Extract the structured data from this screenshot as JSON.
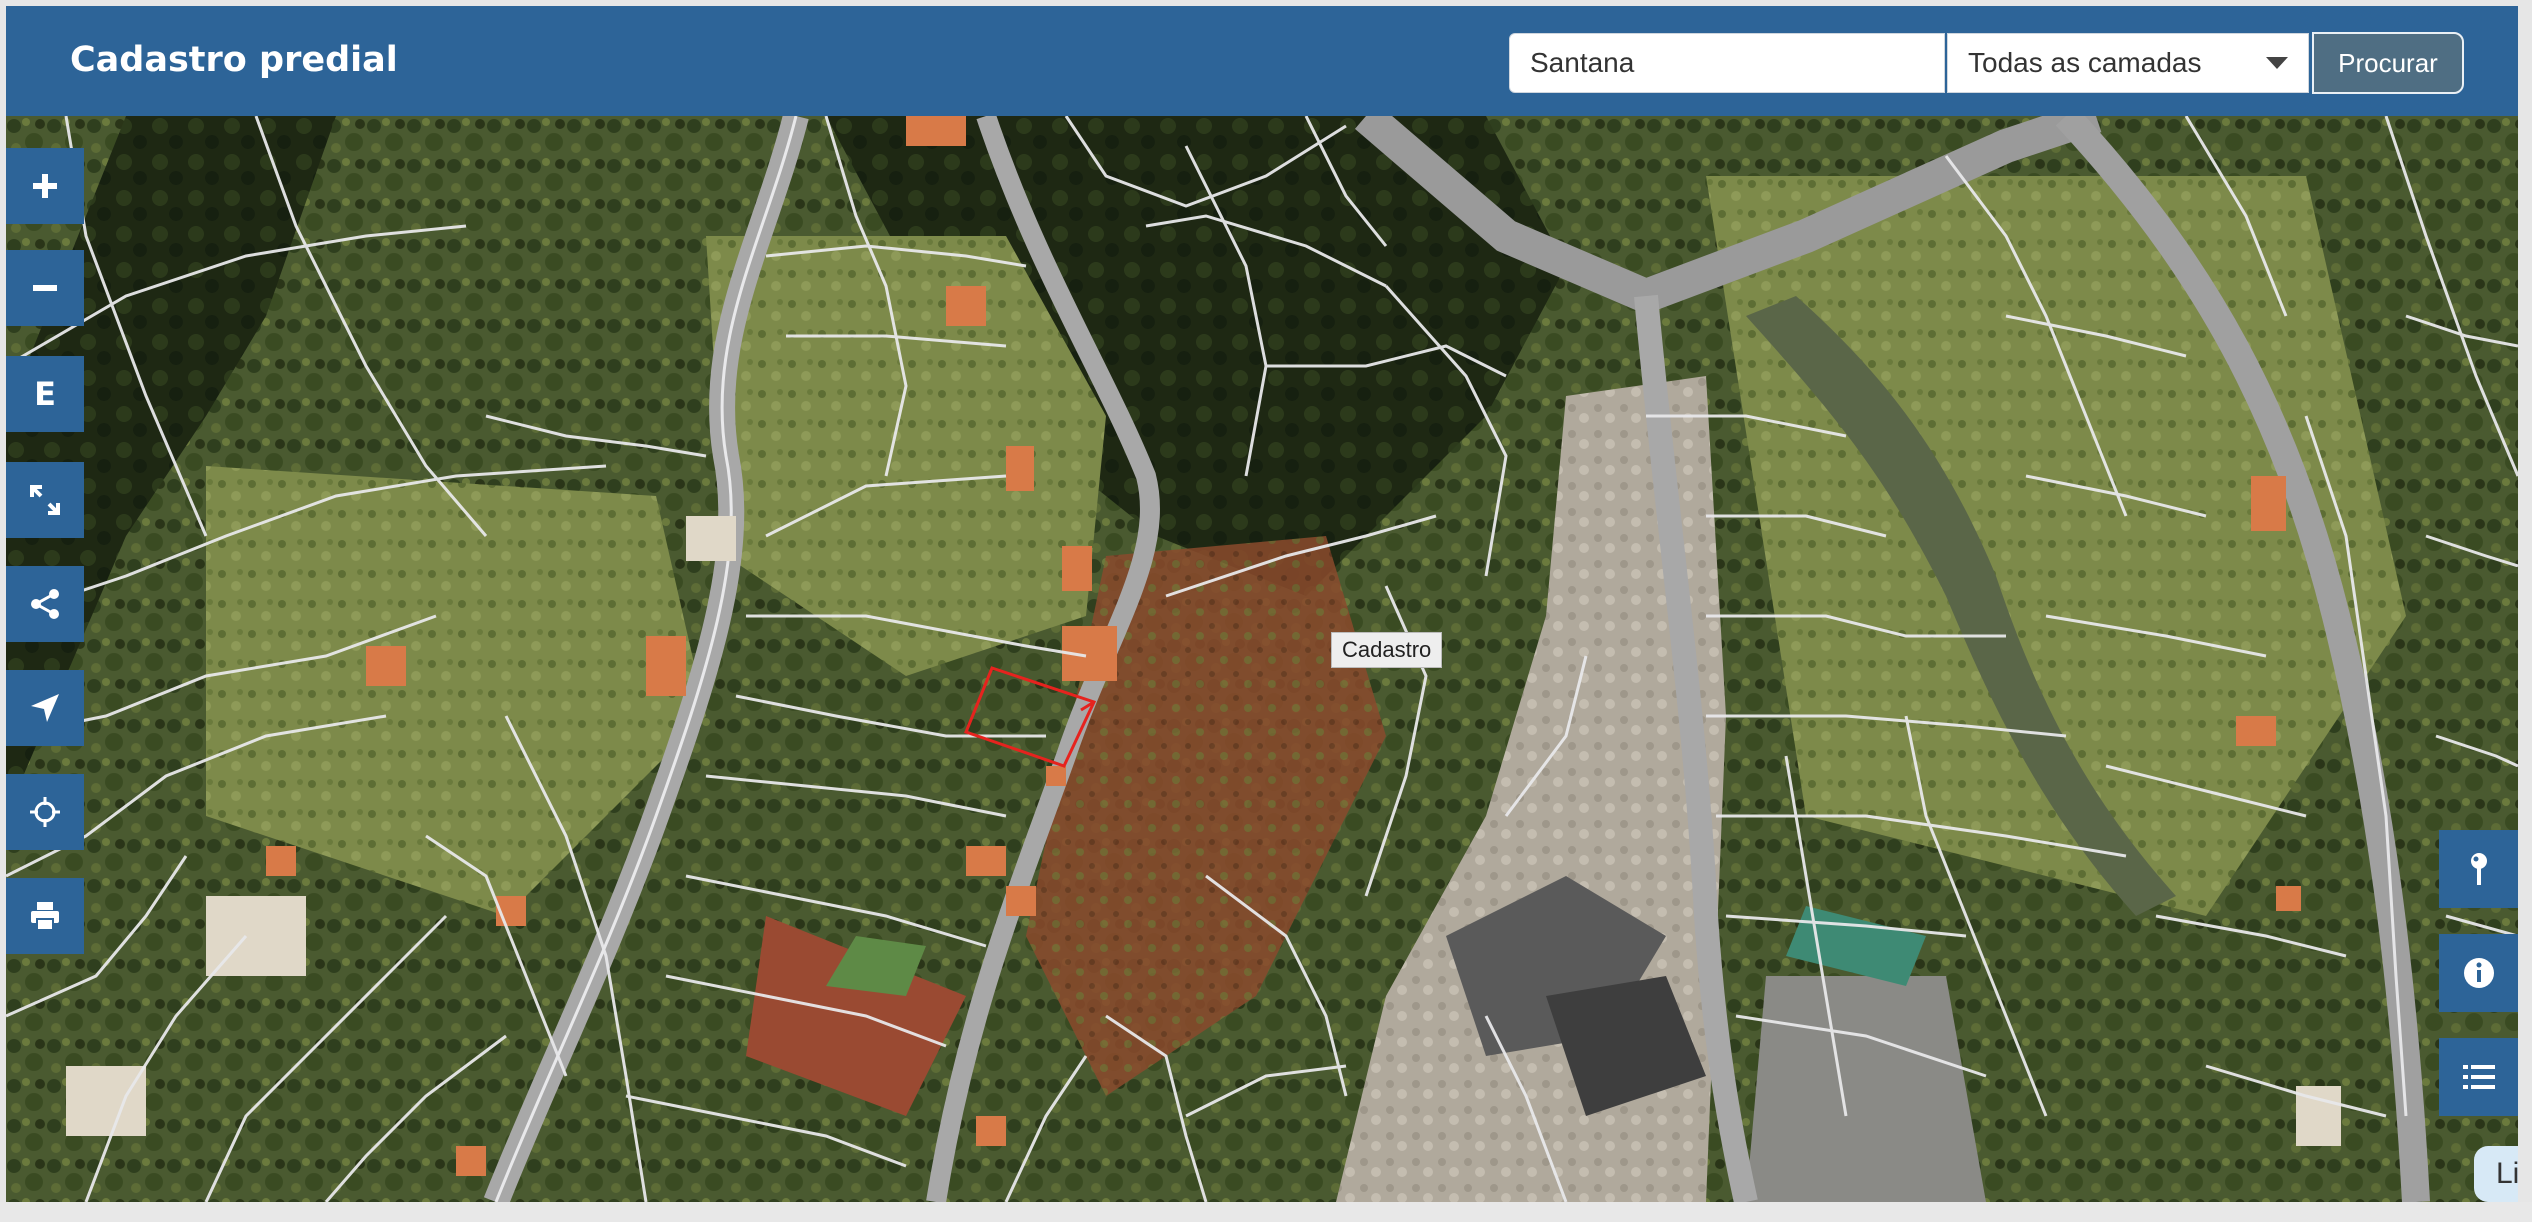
{
  "header": {
    "title": "Cadastro predial",
    "search_value": "Santana",
    "layer_select_value": "Todas as camadas",
    "search_button_label": "Procurar"
  },
  "toolbar_left": [
    {
      "name": "zoom-in-button",
      "icon": "plus-icon"
    },
    {
      "name": "zoom-out-button",
      "icon": "minus-icon"
    },
    {
      "name": "extent-button",
      "icon": "letter-e",
      "label": "E"
    },
    {
      "name": "fullscreen-button",
      "icon": "expand-icon"
    },
    {
      "name": "share-button",
      "icon": "share-icon"
    },
    {
      "name": "locate-button",
      "icon": "location-arrow-icon"
    },
    {
      "name": "crosshair-button",
      "icon": "crosshair-icon"
    },
    {
      "name": "print-button",
      "icon": "print-icon"
    }
  ],
  "toolbar_right": [
    {
      "name": "pin-button",
      "icon": "map-pin-icon"
    },
    {
      "name": "info-button",
      "icon": "info-icon"
    },
    {
      "name": "layers-list-button",
      "icon": "list-icon"
    }
  ],
  "map": {
    "feature_label": "Cadastro",
    "selected_parcel_color": "#e6231e",
    "parcel_line_color": "#e8e8ea"
  },
  "bottom_tab": {
    "label": "Lix"
  },
  "colors": {
    "header": "#2d6498",
    "button": "#4f6e83"
  }
}
